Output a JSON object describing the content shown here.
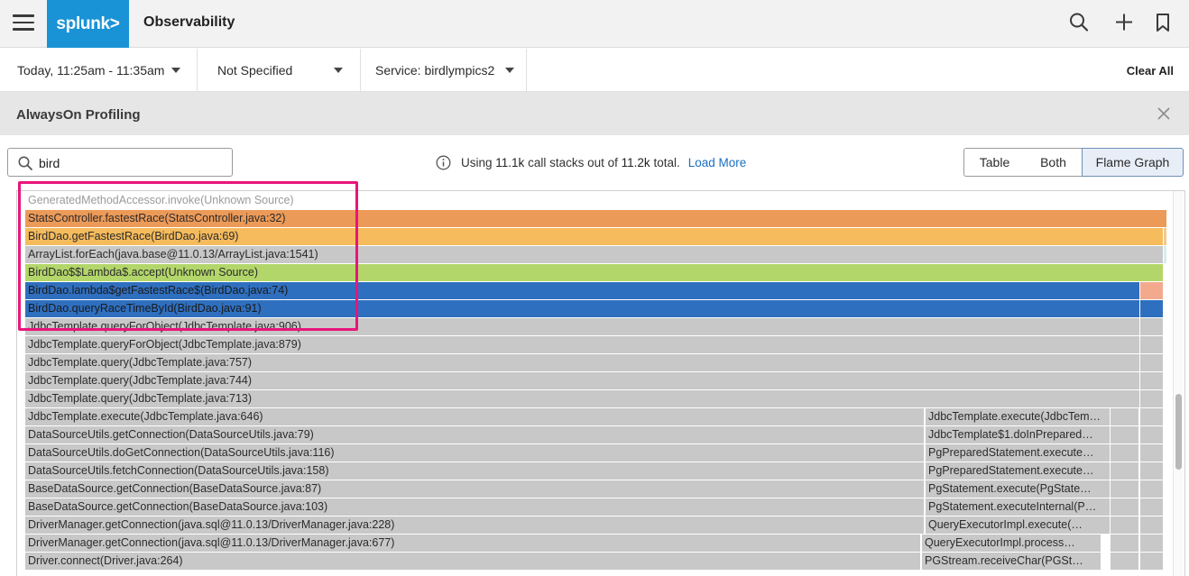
{
  "header": {
    "brand": "splunk>",
    "title": "Observability"
  },
  "filters": {
    "time_range": "Today, 11:25am - 11:35am",
    "environment": "Not Specified",
    "service": "Service: birdlympics2",
    "clear_all": "Clear All"
  },
  "panel": {
    "title": "AlwaysOn Profiling"
  },
  "search": {
    "value": "bird"
  },
  "stack_info": {
    "prefix": "Using",
    "used": "11.1k",
    "middle": "call stacks out of",
    "total": "11.2k",
    "suffix": "total.",
    "load_more": "Load More"
  },
  "view_toggle": {
    "options": [
      "Table",
      "Both",
      "Flame Graph"
    ],
    "selected": "Flame Graph"
  },
  "colors": {
    "orange": "#ec9a58",
    "amber": "#f5bb5c",
    "gray": "#c8c8c8",
    "green": "#b3d66a",
    "blue": "#2f6fbf",
    "salmon": "#f3a98e",
    "highlight": "#e8157a",
    "link": "#1a6fc1"
  },
  "flame_graph": {
    "main_frames": [
      {
        "label": "GeneratedMethodAccessor.invoke(Unknown Source)",
        "color": "faded"
      },
      {
        "label": "StatsController.fastestRace(StatsController.java:32)",
        "color": "#ec9a58"
      },
      {
        "label": "BirdDao.getFastestRace(BirdDao.java:69)",
        "color": "#f5bb5c"
      },
      {
        "label": "ArrayList.forEach(java.base@11.0.13/ArrayList.java:1541)",
        "color": "#c8c8c8"
      },
      {
        "label": "BirdDao$$Lambda$.accept(Unknown Source)",
        "color": "#b3d66a"
      },
      {
        "label": "BirdDao.lambda$getFastestRace$(BirdDao.java:74)",
        "color": "#2f6fbf"
      },
      {
        "label": "BirdDao.queryRaceTimeById(BirdDao.java:91)",
        "color": "#2f6fbf"
      },
      {
        "label": "JdbcTemplate.queryForObject(JdbcTemplate.java:906)",
        "color": "#c8c8c8"
      },
      {
        "label": "JdbcTemplate.queryForObject(JdbcTemplate.java:879)",
        "color": "#c8c8c8"
      },
      {
        "label": "JdbcTemplate.query(JdbcTemplate.java:757)",
        "color": "#c8c8c8"
      },
      {
        "label": "JdbcTemplate.query(JdbcTemplate.java:744)",
        "color": "#c8c8c8"
      },
      {
        "label": "JdbcTemplate.query(JdbcTemplate.java:713)",
        "color": "#c8c8c8"
      },
      {
        "label": "JdbcTemplate.execute(JdbcTemplate.java:646)",
        "color": "#c8c8c8"
      },
      {
        "label": "DataSourceUtils.getConnection(DataSourceUtils.java:79)",
        "color": "#c8c8c8"
      },
      {
        "label": "DataSourceUtils.doGetConnection(DataSourceUtils.java:116)",
        "color": "#c8c8c8"
      },
      {
        "label": "DataSourceUtils.fetchConnection(DataSourceUtils.java:158)",
        "color": "#c8c8c8"
      },
      {
        "label": "BaseDataSource.getConnection(BaseDataSource.java:87)",
        "color": "#c8c8c8"
      },
      {
        "label": "BaseDataSource.getConnection(BaseDataSource.java:103)",
        "color": "#c8c8c8"
      },
      {
        "label": "DriverManager.getConnection(java.sql@11.0.13/DriverManager.java:228)",
        "color": "#c8c8c8"
      },
      {
        "label": "DriverManager.getConnection(java.sql@11.0.13/DriverManager.java:677)",
        "color": "#c8c8c8"
      },
      {
        "label": "Driver.connect(Driver.java:264)",
        "color": "#c8c8c8"
      }
    ],
    "side_frames": [
      {
        "label": "JdbcTemplate.execute(JdbcTem…"
      },
      {
        "label": "JdbcTemplate$1.doInPrepared…"
      },
      {
        "label": "PgPreparedStatement.execute…"
      },
      {
        "label": "PgPreparedStatement.execute…"
      },
      {
        "label": "PgStatement.execute(PgState…"
      },
      {
        "label": "PgStatement.executeInternal(P…"
      },
      {
        "label": "QueryExecutorImpl.execute(…"
      },
      {
        "label": "QueryExecutorImpl.process…"
      },
      {
        "label": "PGStream.receiveChar(PGSt…"
      }
    ]
  }
}
